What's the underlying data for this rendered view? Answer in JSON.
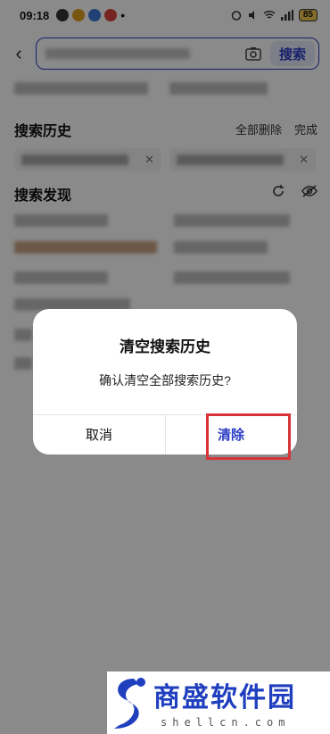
{
  "status_bar": {
    "time": "09:18",
    "battery": "85"
  },
  "header": {
    "search_placeholder": "",
    "search_button": "搜索"
  },
  "history": {
    "title": "搜索历史",
    "delete_all": "全部删除",
    "done": "完成"
  },
  "discover": {
    "title": "搜索发现"
  },
  "dialog": {
    "title": "清空搜索历史",
    "message": "确认清空全部搜索历史?",
    "cancel": "取消",
    "clear": "清除"
  },
  "watermark": {
    "brand": "商盛软件园",
    "domain": "shellcn.com"
  },
  "colors": {
    "accent": "#2a3cc4",
    "highlight": "#d9333a",
    "overlay": "rgba(0,0,0,0.46)"
  }
}
